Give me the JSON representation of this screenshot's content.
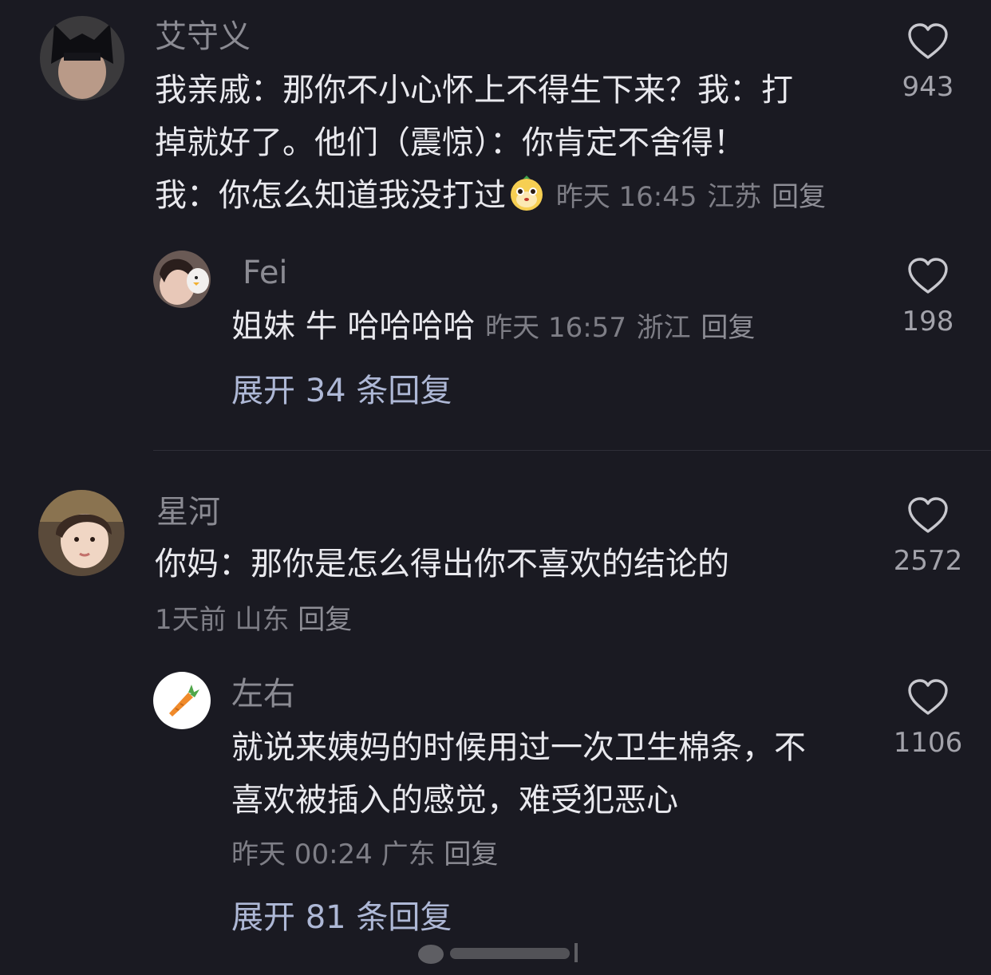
{
  "comments": [
    {
      "user": "艾守义",
      "lines": [
        "我亲戚：那你不小心怀上不得生下来？我：打",
        "掉就好了。他们（震惊）：你肯定不舍得！",
        "我：你怎么知道我没打过"
      ],
      "emoji": "dog-face-emoji",
      "time": "昨天 16:45",
      "location": "江苏",
      "reply_label": "回复",
      "likes": "943",
      "sub_reply": {
        "user": "Fei",
        "text": "姐妹 牛 哈哈哈哈",
        "time": "昨天 16:57",
        "location": "浙江",
        "reply_label": "回复",
        "likes": "198"
      },
      "expand_label": "展开 34 条回复"
    },
    {
      "user": "星河",
      "lines": [
        "你妈：那你是怎么得出你不喜欢的结论的"
      ],
      "time": "1天前",
      "location": "山东",
      "reply_label": "回复",
      "likes": "2572",
      "sub_reply": {
        "user": "左右",
        "lines": [
          "就说来姨妈的时候用过一次卫生棉条，不",
          "喜欢被插入的感觉，难受犯恶心"
        ],
        "time": "昨天 00:24",
        "location": "广东",
        "reply_label": "回复",
        "likes": "1106"
      },
      "expand_label": "展开 81 条回复"
    }
  ],
  "colors": {
    "background": "#1a1a22",
    "text": "#e9e9ee",
    "muted": "#7e7e86",
    "expand": "#aeb8d6"
  },
  "icons": [
    "heart-outline-icon",
    "carrot-icon"
  ]
}
